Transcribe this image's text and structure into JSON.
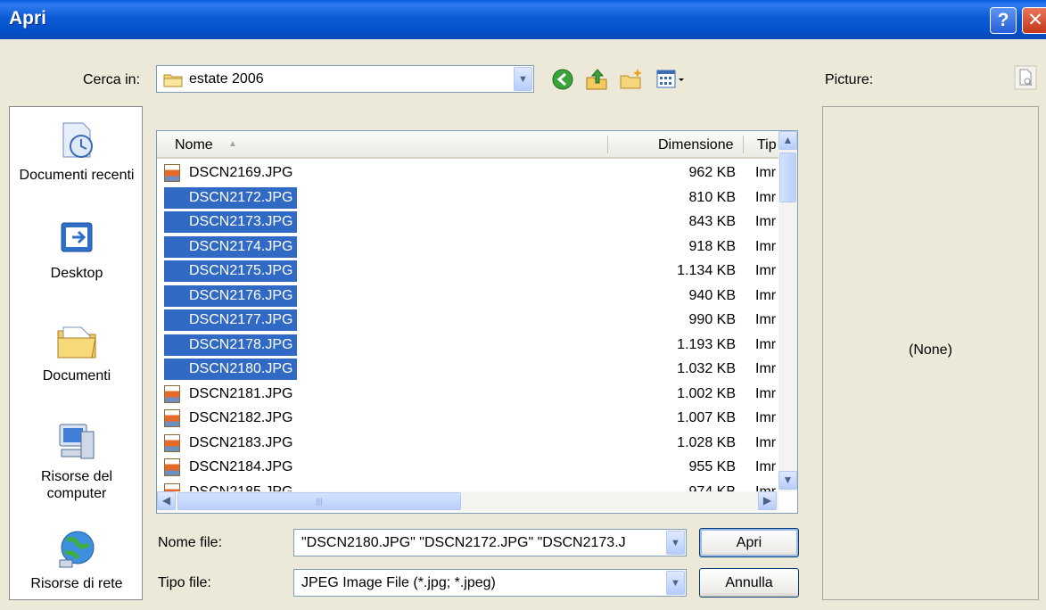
{
  "window": {
    "title": "Apri",
    "help": "?",
    "close": "✕"
  },
  "places": [
    {
      "label": "Documenti recenti",
      "icon": "recent-documents-icon"
    },
    {
      "label": "Desktop",
      "icon": "desktop-icon"
    },
    {
      "label": "Documenti",
      "icon": "my-documents-icon"
    },
    {
      "label": "Risorse del computer",
      "icon": "my-computer-icon"
    },
    {
      "label": "Risorse di rete",
      "icon": "network-places-icon"
    }
  ],
  "lookin": {
    "label": "Cerca in:",
    "value": "estate 2006"
  },
  "toolbar": {
    "icons": [
      "back-icon",
      "up-folder-icon",
      "new-folder-icon",
      "views-menu-icon"
    ]
  },
  "preview": {
    "label": "Picture:",
    "value": "(None)"
  },
  "columns": {
    "name": "Nome",
    "size": "Dimensione",
    "type": "Tip"
  },
  "files": [
    {
      "name": "DSCN2169.JPG",
      "size": "962 KB",
      "type": "Imr",
      "selected": false
    },
    {
      "name": "DSCN2172.JPG",
      "size": "810 KB",
      "type": "Imr",
      "selected": true
    },
    {
      "name": "DSCN2173.JPG",
      "size": "843 KB",
      "type": "Imr",
      "selected": true
    },
    {
      "name": "DSCN2174.JPG",
      "size": "918 KB",
      "type": "Imr",
      "selected": true
    },
    {
      "name": "DSCN2175.JPG",
      "size": "1.134 KB",
      "type": "Imr",
      "selected": true
    },
    {
      "name": "DSCN2176.JPG",
      "size": "940 KB",
      "type": "Imr",
      "selected": true
    },
    {
      "name": "DSCN2177.JPG",
      "size": "990 KB",
      "type": "Imr",
      "selected": true
    },
    {
      "name": "DSCN2178.JPG",
      "size": "1.193 KB",
      "type": "Imr",
      "selected": true
    },
    {
      "name": "DSCN2180.JPG",
      "size": "1.032 KB",
      "type": "Imr",
      "selected": true
    },
    {
      "name": "DSCN2181.JPG",
      "size": "1.002 KB",
      "type": "Imr",
      "selected": false
    },
    {
      "name": "DSCN2182.JPG",
      "size": "1.007 KB",
      "type": "Imr",
      "selected": false
    },
    {
      "name": "DSCN2183.JPG",
      "size": "1.028 KB",
      "type": "Imr",
      "selected": false
    },
    {
      "name": "DSCN2184.JPG",
      "size": "955 KB",
      "type": "Imr",
      "selected": false
    },
    {
      "name": "DSCN2185.JPG",
      "size": "974 KB",
      "type": "Imr",
      "selected": false
    }
  ],
  "filename": {
    "label": "Nome file:",
    "value": "\"DSCN2180.JPG\" \"DSCN2172.JPG\" \"DSCN2173.J"
  },
  "filetype": {
    "label": "Tipo file:",
    "value": "JPEG Image File (*.jpg; *.jpeg)"
  },
  "buttons": {
    "open": "Apri",
    "cancel": "Annulla"
  },
  "colors": {
    "selection": "#316ac5",
    "dialog_bg": "#ece9d8",
    "titlebar": "#0b5ad6"
  }
}
